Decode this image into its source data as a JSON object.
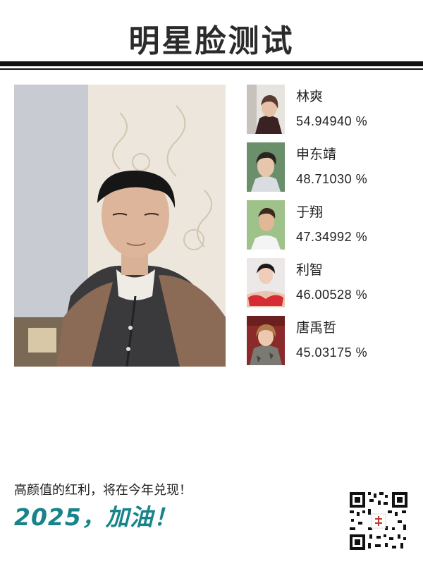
{
  "header": {
    "title": "明星脸测试"
  },
  "matches": [
    {
      "name": "林爽",
      "score": "54.94940 %"
    },
    {
      "name": "申东靖",
      "score": "48.71030 %"
    },
    {
      "name": "于翔",
      "score": "47.34992 %"
    },
    {
      "name": "利智",
      "score": "46.00528 %"
    },
    {
      "name": "唐禹哲",
      "score": "45.03175 %"
    }
  ],
  "footer": {
    "tagline": "高颜值的红利，将在今年兑现！",
    "slogan": "2025，加油！"
  },
  "colors": {
    "slogan": "#17848a",
    "rule": "#111111"
  },
  "icons": {
    "qr": "qr-code-icon"
  }
}
